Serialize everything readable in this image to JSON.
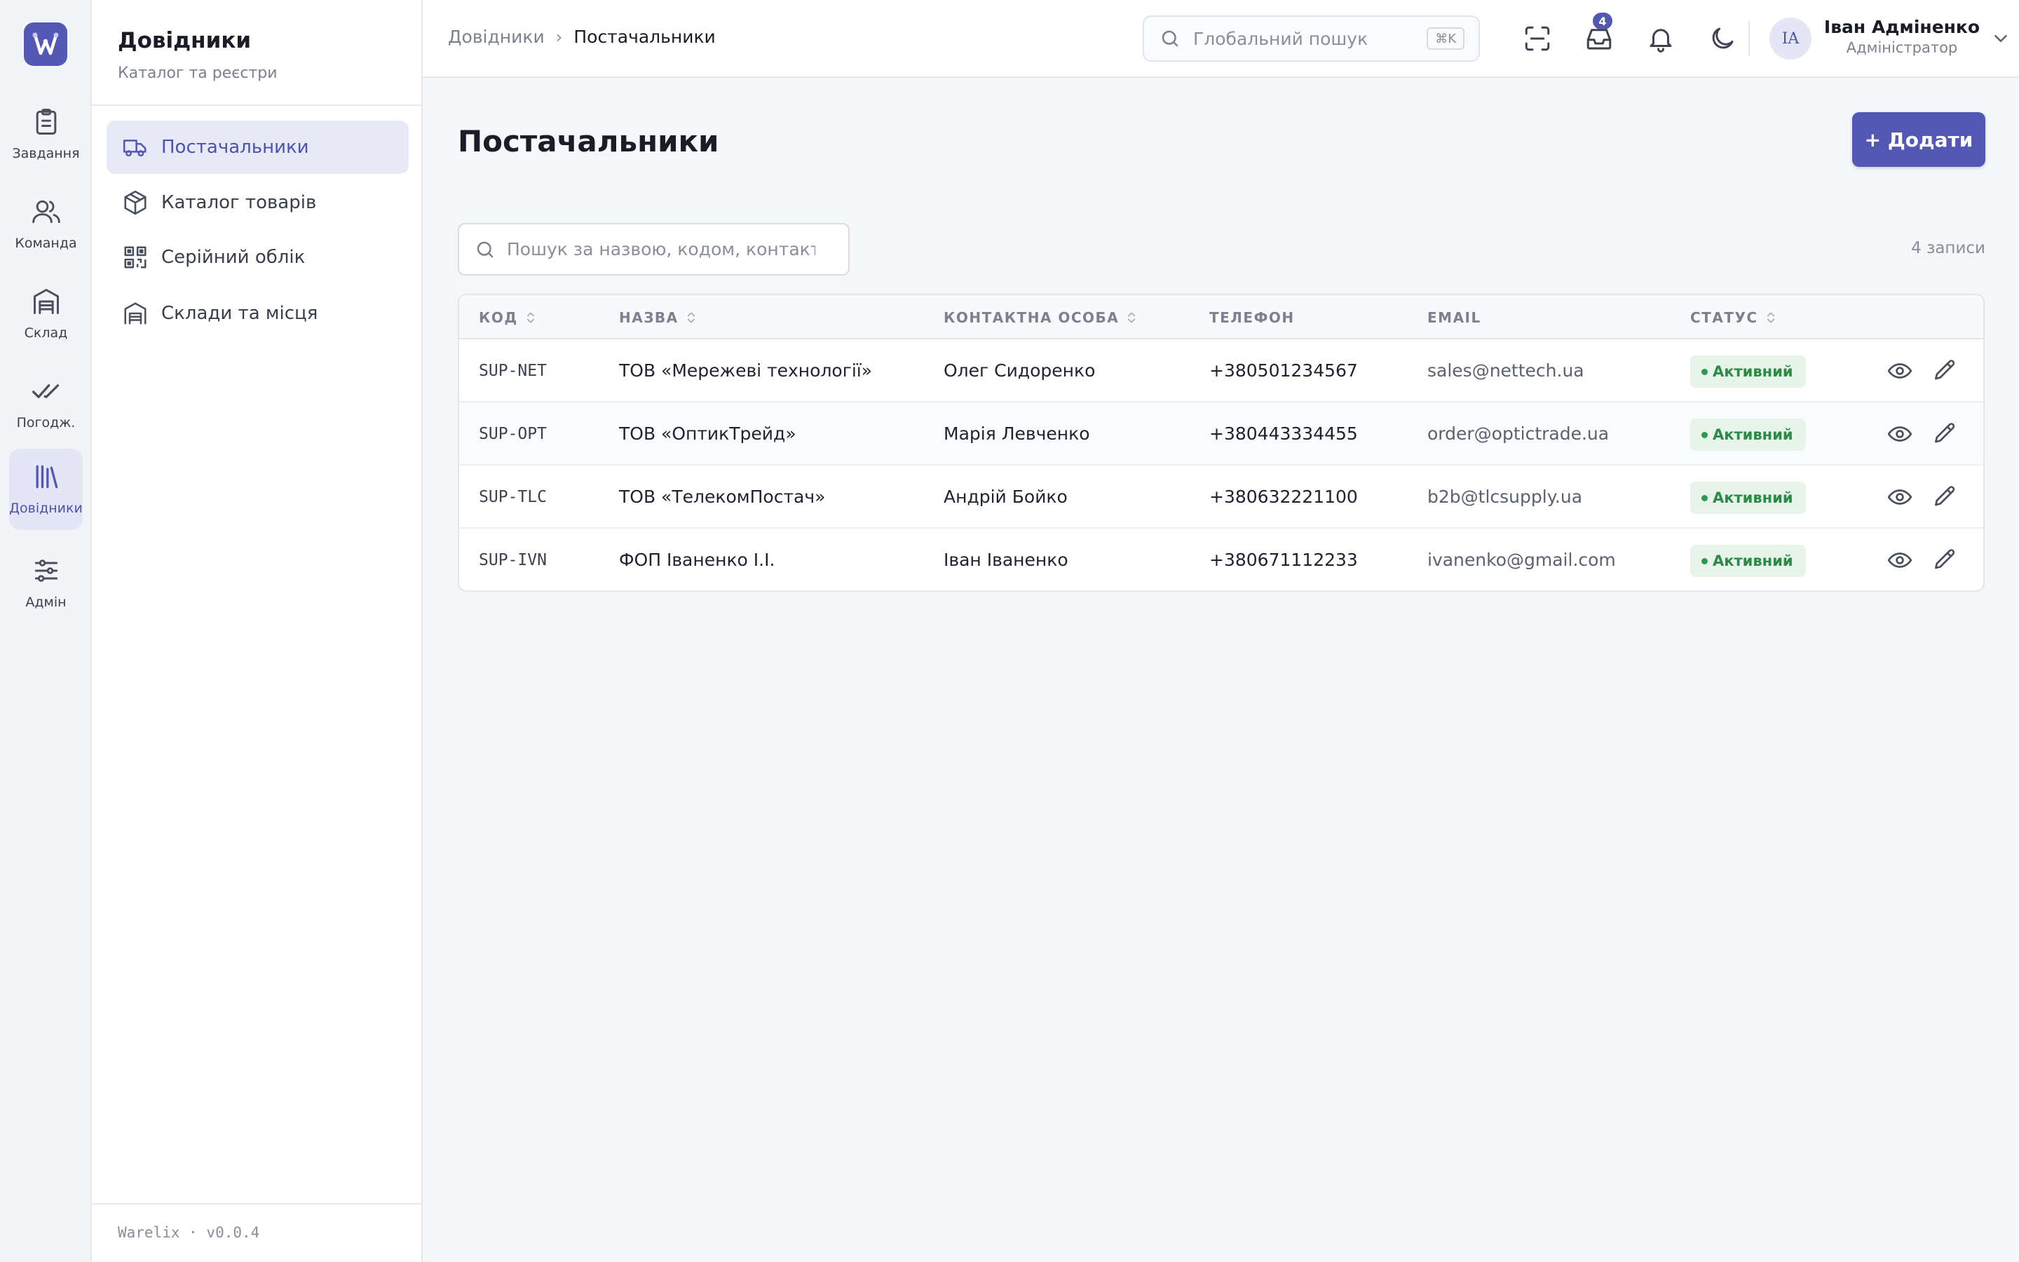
{
  "rail": {
    "items": [
      {
        "label": "Завдання",
        "icon": "clipboard-icon"
      },
      {
        "label": "Команда",
        "icon": "users-icon"
      },
      {
        "label": "Склад",
        "icon": "warehouse-icon"
      },
      {
        "label": "Погодж.",
        "icon": "double-check-icon"
      },
      {
        "label": "Довідники",
        "icon": "library-icon",
        "active": true
      },
      {
        "label": "Адмін",
        "icon": "sliders-icon"
      }
    ]
  },
  "sidebar": {
    "title": "Довідники",
    "subtitle": "Каталог та реєстри",
    "items": [
      {
        "label": "Постачальники",
        "icon": "truck-icon",
        "active": true
      },
      {
        "label": "Каталог товарів",
        "icon": "box-icon"
      },
      {
        "label": "Серійний облік",
        "icon": "qr-code-icon"
      },
      {
        "label": "Склади та місця",
        "icon": "warehouse-icon"
      }
    ],
    "footer": "Warelix · v0.0.4"
  },
  "header": {
    "breadcrumb": [
      "Довідники",
      "Постачальники"
    ],
    "search_placeholder": "Глобальний пошук",
    "search_shortcut": "⌘K",
    "inbox_badge": "4",
    "user": {
      "initials": "IA",
      "name": "Іван Адміненко",
      "role": "Адміністратор"
    }
  },
  "main": {
    "title": "Постачальники",
    "add_label": "+ Додати",
    "table_search_placeholder": "Пошук за назвою, кодом, контактом",
    "record_count": "4 записи",
    "columns": [
      "КОД",
      "НАЗВА",
      "КОНТАКТНА ОСОБА",
      "ТЕЛЕФОН",
      "EMAIL",
      "СТАТУС"
    ],
    "rows": [
      {
        "code": "SUP-NET",
        "name": "ТОВ «Мережеві технології»",
        "contact": "Олег Сидоренко",
        "phone": "+380501234567",
        "email": "sales@nettech.ua",
        "status": "Активний"
      },
      {
        "code": "SUP-OPT",
        "name": "ТОВ «ОптикТрейд»",
        "contact": "Марія Левченко",
        "phone": "+380443334455",
        "email": "order@optictrade.ua",
        "status": "Активний"
      },
      {
        "code": "SUP-TLC",
        "name": "ТОВ «ТелекомПостач»",
        "contact": "Андрій Бойко",
        "phone": "+380632221100",
        "email": "b2b@tlcsupply.ua",
        "status": "Активний"
      },
      {
        "code": "SUP-IVN",
        "name": "ФОП Іваненко І.І.",
        "contact": "Іван Іваненко",
        "phone": "+380671112233",
        "email": "ivanenko@gmail.com",
        "status": "Активний"
      }
    ]
  },
  "colors": {
    "accent": "#5258b4",
    "status_bg": "#e6f4ea",
    "status_fg": "#2c8a47"
  }
}
